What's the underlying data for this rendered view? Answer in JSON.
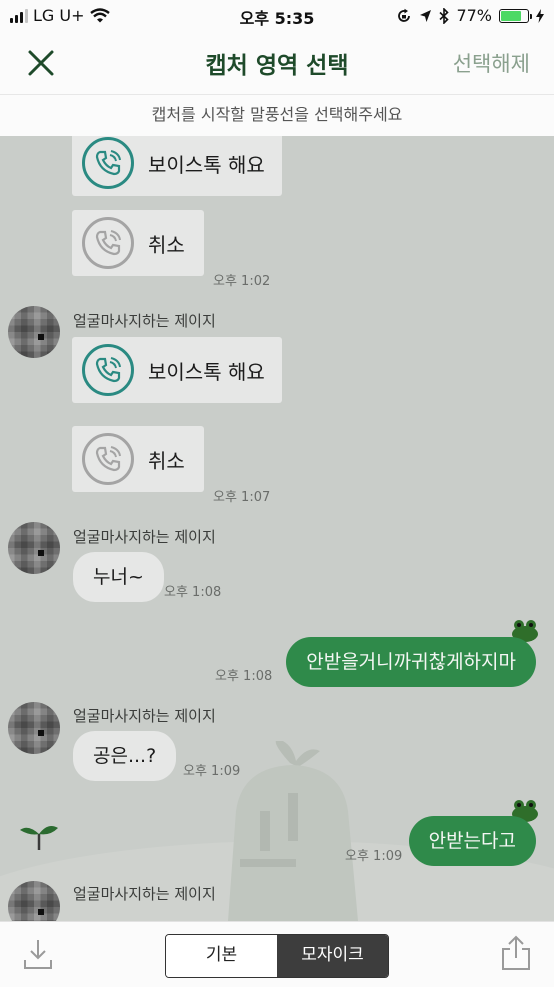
{
  "status_bar": {
    "carrier": "LG U+",
    "time": "오후 5:35",
    "battery": "77%",
    "battery_level": 0.77
  },
  "nav": {
    "title": "캡처 영역 선택",
    "deselect_label": "선택해제"
  },
  "hint": "캡처를 시작할 말풍선을 선택해주세요",
  "chat": {
    "messages": [
      {
        "type": "call",
        "label": "보이스톡 해요"
      },
      {
        "type": "call-cancel",
        "label": "취소",
        "time": "오후 1:02"
      },
      {
        "sender": "얼굴마사지하는 제이지"
      },
      {
        "type": "call",
        "label": "보이스톡 해요"
      },
      {
        "type": "call-cancel",
        "label": "취소",
        "time": "오후 1:07"
      },
      {
        "sender": "얼굴마사지하는 제이지",
        "text": "누너~",
        "time": "오후 1:08"
      },
      {
        "mine": true,
        "text": "안받을거니까귀찮게하지마",
        "time": "오후 1:08"
      },
      {
        "sender": "얼굴마사지하는 제이지",
        "text": "공은...?",
        "time": "오후 1:09"
      },
      {
        "mine": true,
        "text": "안받는다고",
        "time": "오후 1:09"
      },
      {
        "sender": "얼굴마사지하는 제이지"
      }
    ]
  },
  "bottom_bar": {
    "basic_label": "기본",
    "mosaic_label": "모자이크",
    "selected": "모자이크"
  }
}
